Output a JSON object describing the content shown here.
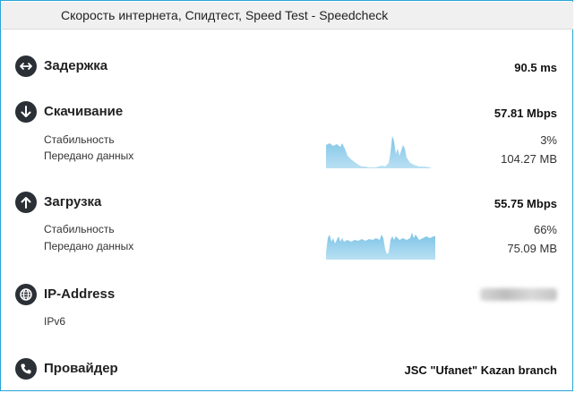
{
  "window": {
    "title": "Скорость интернета, Спидтест, Speed Test - Speedcheck"
  },
  "latency": {
    "label": "Задержка",
    "value": "90.5 ms",
    "icon": "arrows-horizontal-icon"
  },
  "download": {
    "label": "Скачивание",
    "value": "57.81 Mbps",
    "icon": "arrow-down-icon",
    "stability_label": "Стабильность",
    "stability_value": "3%",
    "transferred_label": "Передано данных",
    "transferred_value": "104.27 MB"
  },
  "upload": {
    "label": "Загрузка",
    "value": "55.75 Mbps",
    "icon": "arrow-up-icon",
    "stability_label": "Стабильность",
    "stability_value": "66%",
    "transferred_label": "Передано данных",
    "transferred_value": "75.09 MB"
  },
  "ip": {
    "label": "IP-Address",
    "sub": "IPv6",
    "icon": "globe-icon"
  },
  "provider": {
    "label": "Провайдер",
    "value": "JSC \"Ufanet\" Kazan branch",
    "icon": "phone-icon"
  },
  "colors": {
    "accent": "#29a3d6",
    "graph_fill": "#8fcbe8",
    "icon_bg": "#2b2f36"
  }
}
